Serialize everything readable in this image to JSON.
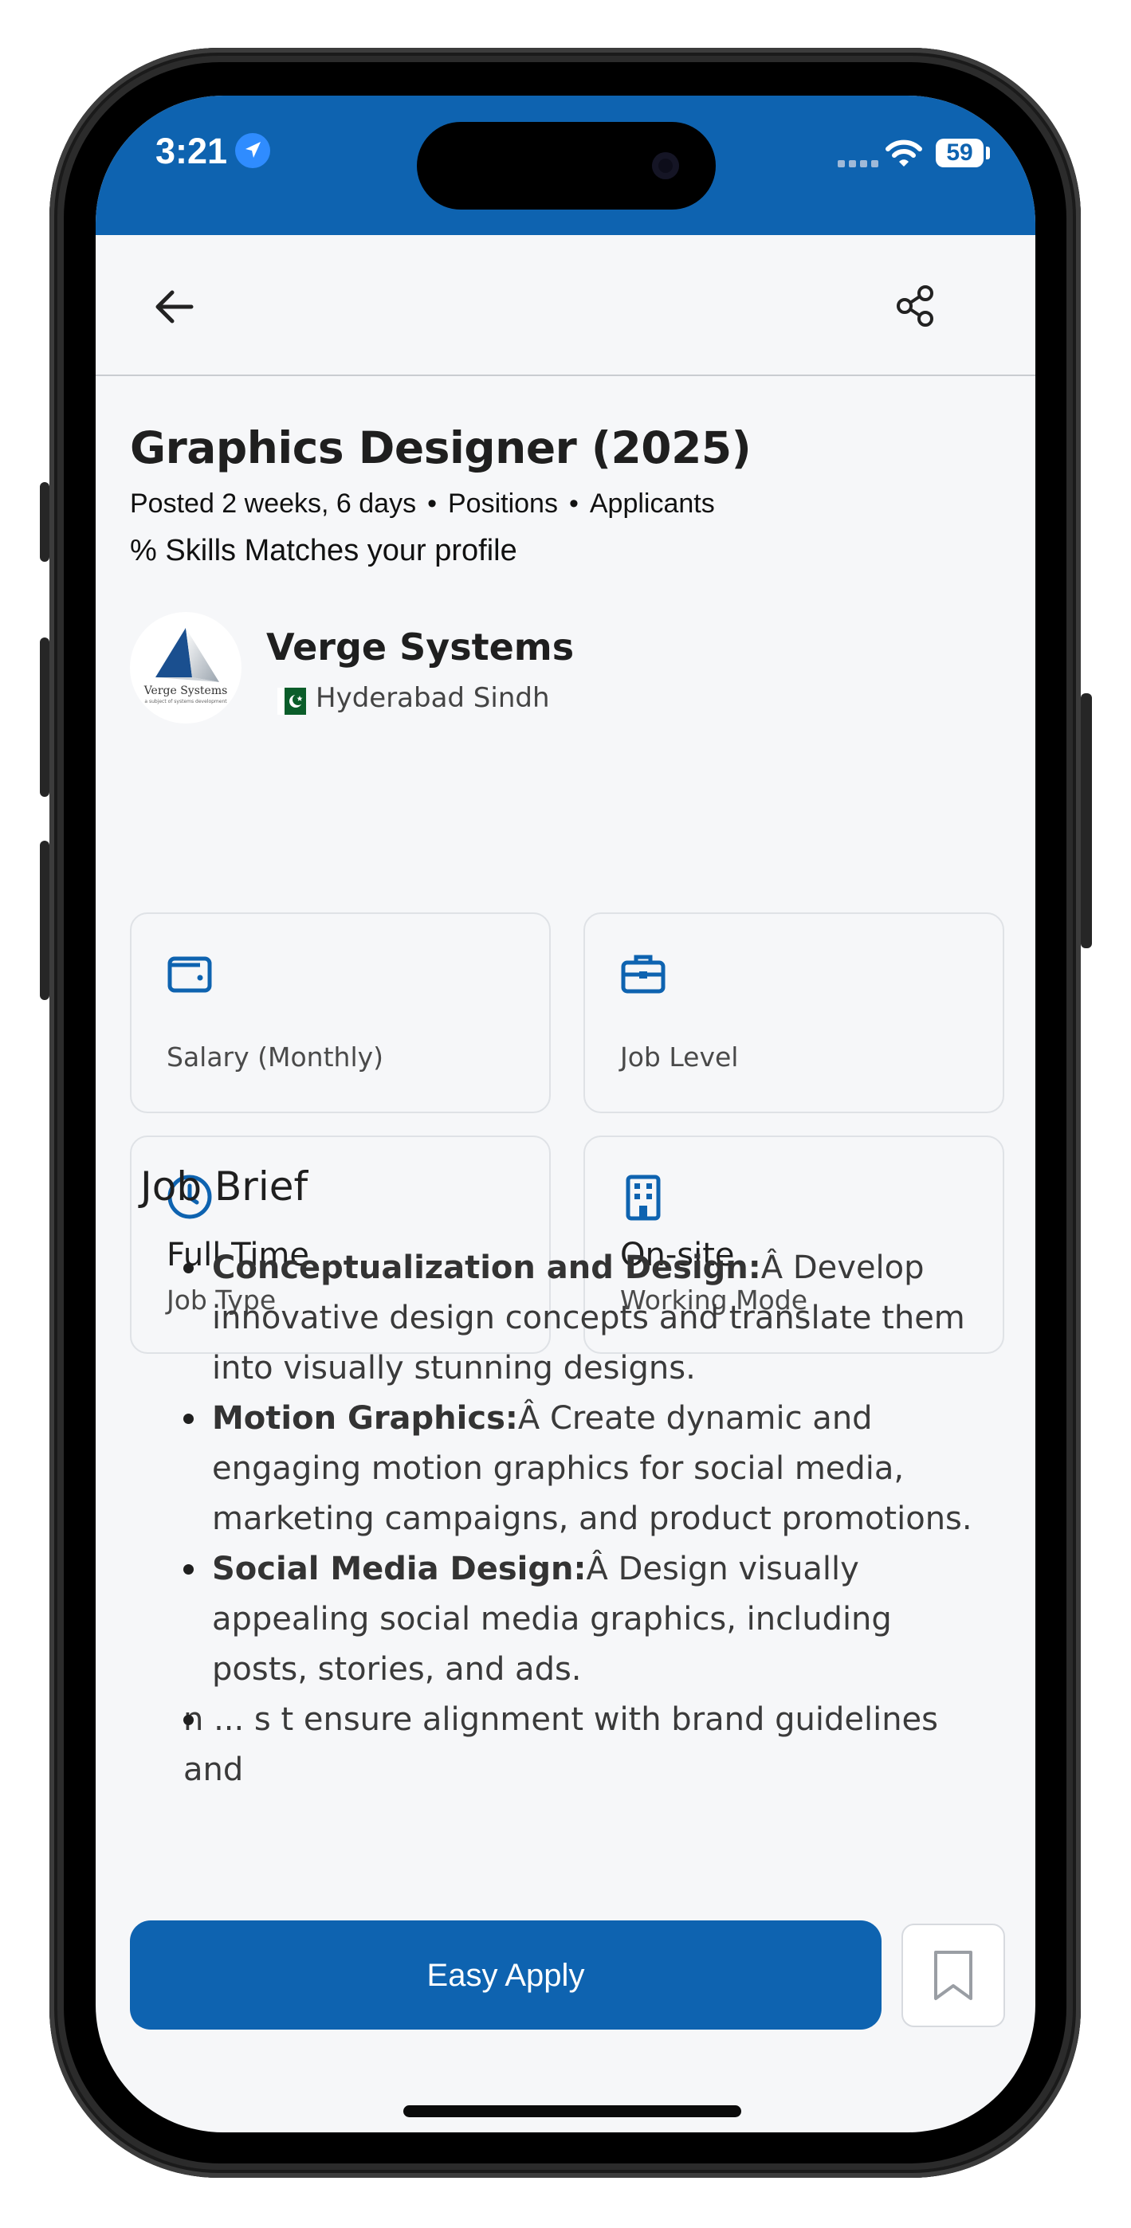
{
  "status_bar": {
    "time": "3:21",
    "battery": "59"
  },
  "app_bar": {
    "back_icon": "arrow-left-icon",
    "share_icon": "share-icon"
  },
  "job": {
    "title": "Graphics Designer (2025)",
    "posted": "Posted 2 weeks, 6 days",
    "positions": "Positions",
    "applicants": "Applicants",
    "skills_match": "% Skills Matches your profile"
  },
  "company": {
    "name": "Verge Systems",
    "location": "Hyderabad Sindh",
    "logo_text": "Verge Systems",
    "logo_tagline": "a subject of systems development",
    "flag": "pakistan-flag-icon"
  },
  "details": {
    "salary": {
      "value": "",
      "label": "Salary (Monthly)",
      "icon": "wallet-icon"
    },
    "level": {
      "value": "",
      "label": "Job Level",
      "icon": "briefcase-icon"
    },
    "type": {
      "value": "Full Time",
      "label": "Job Type",
      "icon": "clock-icon"
    },
    "mode": {
      "value": "On-site",
      "label": "Working Mode",
      "icon": "building-icon"
    }
  },
  "brief": {
    "heading": "Job Brief",
    "items": [
      {
        "title": "Conceptualization and Design:",
        "text": "Â Develop innovative design concepts and translate them into visually stunning designs."
      },
      {
        "title": "Motion Graphics:",
        "text": "Â Create dynamic and engaging motion graphics for social media, marketing campaigns, and product promotions."
      },
      {
        "title": "Social Media Design:",
        "text": "Â Design visually appealing social media graphics, including posts, stories, and ads."
      },
      {
        "title": "",
        "text": "n ... s t ensure alignment with brand guidelines and"
      }
    ]
  },
  "actions": {
    "apply": "Easy Apply",
    "save_icon": "bookmark-icon"
  },
  "colors": {
    "primary": "#0e63b0",
    "background": "#f6f7f9",
    "border": "#dfe2e6"
  }
}
